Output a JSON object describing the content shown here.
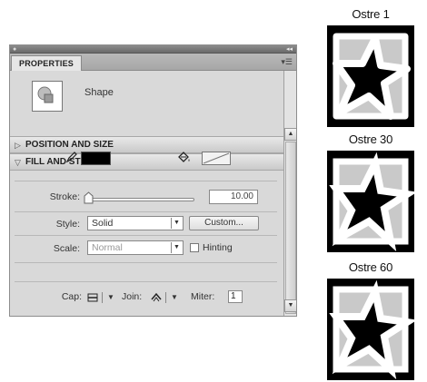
{
  "panel": {
    "tab": "PROPERTIES",
    "object_type": "Shape",
    "sections": {
      "position_and_size": "POSITION AND SIZE",
      "fill_and_stroke": "FILL AND STROKE"
    },
    "fill_stroke": {
      "stroke_color": "#000000",
      "stroke_label": "Stroke:",
      "stroke_value": "10.00",
      "style_label": "Style:",
      "style_value": "Solid",
      "custom_button": "Custom...",
      "scale_label": "Scale:",
      "scale_value": "Normal",
      "hinting_label": "Hinting",
      "cap_label": "Cap:",
      "join_label": "Join:",
      "miter_label": "Miter:",
      "miter_value": "1"
    }
  },
  "examples": [
    {
      "title": "Ostre 1"
    },
    {
      "title": "Ostre 30"
    },
    {
      "title": "Ostre 60"
    }
  ]
}
